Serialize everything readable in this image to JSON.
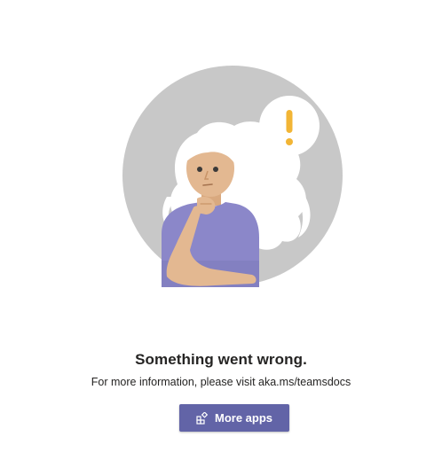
{
  "error": {
    "title": "Something went wrong.",
    "detail": "For more information, please visit aka.ms/teamsdocs"
  },
  "actions": {
    "more_apps_label": "More apps",
    "more_apps_icon": "apps-add-icon"
  },
  "illustration": {
    "subject": "thinking-woman",
    "thought_icon": "exclamation-icon"
  },
  "colors": {
    "accent": "#6264a7",
    "circle": "#c8c8c8",
    "exclamation": "#f2b535",
    "shirt": "#8b87c9",
    "skin": "#e3b891",
    "text": "#252423"
  }
}
